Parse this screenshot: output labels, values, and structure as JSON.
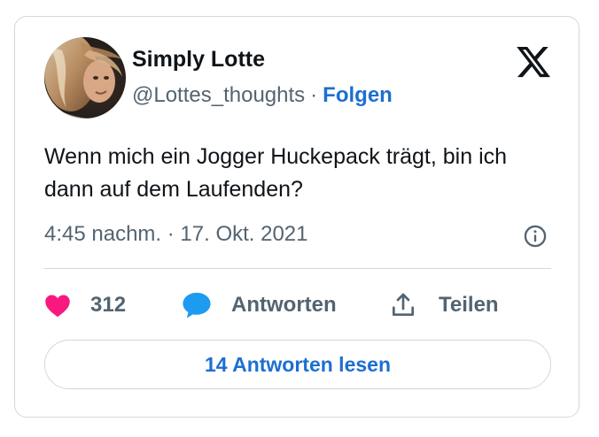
{
  "author": {
    "name": "Simply Lotte",
    "handle": "@Lottes_thoughts",
    "separator": "·",
    "follow_label": "Folgen",
    "avatar_icon": "profile-photo"
  },
  "tweet": {
    "text": "Wenn mich ein Jogger Huckepack trägt, bin ich dann auf dem Laufenden?",
    "timestamp": "4:45 nachm. · 17. Okt. 2021"
  },
  "actions": {
    "likes_count": "312",
    "reply_label": "Antworten",
    "share_label": "Teilen"
  },
  "read_replies_label": "14 Antworten lesen",
  "icons": {
    "brand": "x-logo-icon",
    "info": "info-icon",
    "like": "heart-icon",
    "reply": "speech-bubble-icon",
    "share": "share-icon"
  },
  "colors": {
    "text": "#0f1419",
    "secondary": "#536471",
    "link": "#1d6fd1",
    "like": "#f91880",
    "reply": "#1d9bf0",
    "border": "#cfd9de"
  }
}
